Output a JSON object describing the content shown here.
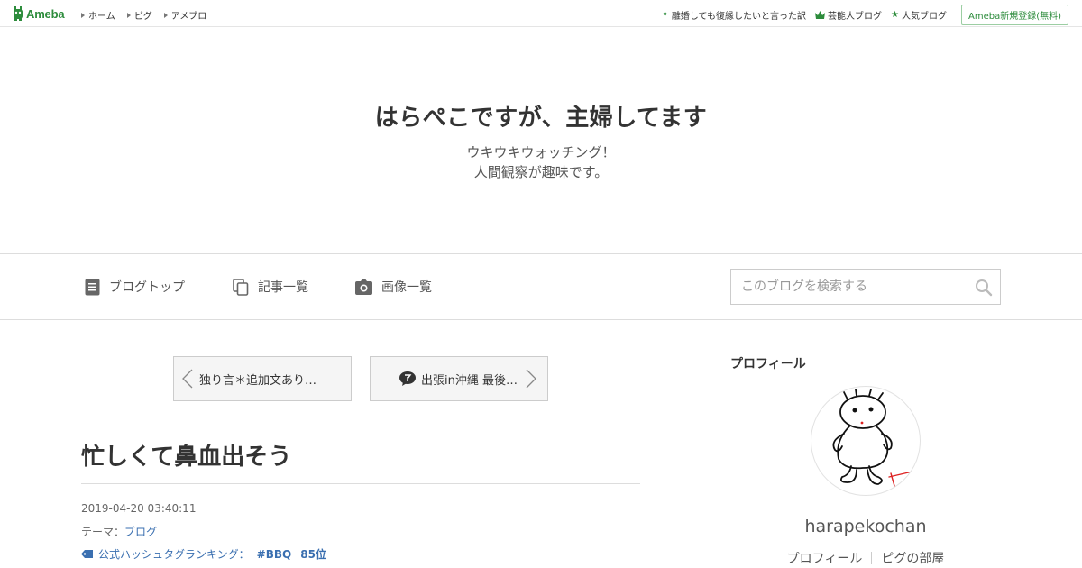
{
  "topbar": {
    "logo_text": "Ameba",
    "nav": [
      "ホーム",
      "ピグ",
      "アメブロ"
    ],
    "right_links": [
      {
        "icon": "sparkle-icon",
        "label": "離婚しても復縁したいと言った訳"
      },
      {
        "icon": "crown-icon",
        "label": "芸能人ブログ"
      },
      {
        "icon": "star-icon",
        "label": "人気ブログ"
      }
    ],
    "register_label": "Ameba新規登録(無料)"
  },
  "header": {
    "title": "はらぺこですが、主婦してます",
    "desc_line1": "ウキウキウォッチング！",
    "desc_line2": "人間観察が趣味です。"
  },
  "nav": {
    "items": [
      {
        "icon": "document-icon",
        "label": "ブログトップ"
      },
      {
        "icon": "copy-icon",
        "label": "記事一覧"
      },
      {
        "icon": "camera-icon",
        "label": "画像一覧"
      }
    ],
    "search_placeholder": "このブログを検索する"
  },
  "pager": {
    "prev_label": "独り言＊追加文あり…",
    "next_label": "出張in沖縄 最後…"
  },
  "article": {
    "title": "忙しくて鼻血出そう",
    "date": "2019-04-20 03:40:11",
    "theme_prefix": "テーマ：",
    "theme": "ブログ",
    "hashtag_ranking_label": "公式ハッシュタグランキング：",
    "hashtag": "#BBQ",
    "rank": "85位"
  },
  "sidebar": {
    "heading": "プロフィール",
    "username": "harapekochan",
    "links": [
      "プロフィール",
      "ピグの部屋"
    ]
  },
  "colors": {
    "brand_green": "#2d8c3c",
    "link_blue": "#3a6fb0"
  }
}
